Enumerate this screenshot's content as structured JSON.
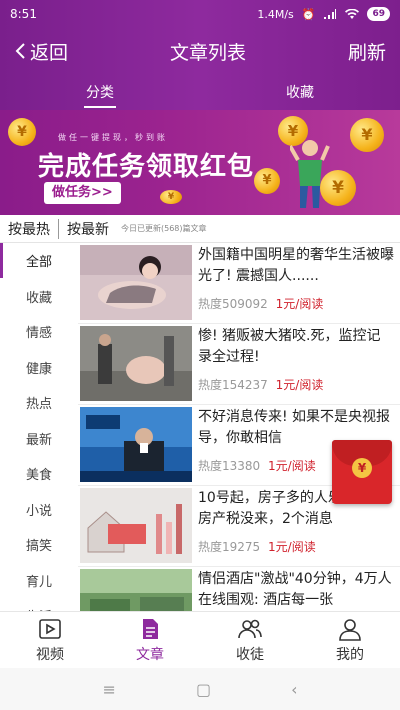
{
  "status": {
    "time": "8:51",
    "speed": "1.4M/s",
    "battery": "69"
  },
  "header": {
    "back_label": "返回",
    "title": "文章列表",
    "refresh_label": "刷新"
  },
  "subtabs": [
    {
      "label": "分类"
    },
    {
      "label": "收藏"
    }
  ],
  "banner": {
    "small_text": "做任一键提现，秒到账",
    "main_text": "完成任务领取红包",
    "button_label": "做任务>>"
  },
  "filter": {
    "hot_label": "按最热",
    "new_label": "按最新",
    "update_note": "今日已更新(568)篇文章"
  },
  "categories": [
    "全部",
    "收藏",
    "情感",
    "健康",
    "热点",
    "最新",
    "美食",
    "小说",
    "搞笑",
    "育儿",
    "生活"
  ],
  "articles": [
    {
      "title": "外国籍中国明星的奢华生活被曝 光了! 震撼国人......",
      "heat_label": "热度509092",
      "price": "1元/阅读"
    },
    {
      "title": "惨! 猪贩被大猪咬.死，监控记录全过程!",
      "heat_label": "热度154237",
      "price": "1元/阅读"
    },
    {
      "title": "不好消息传来! 如果不是央视报导，你敢相信",
      "heat_label": "热度13380",
      "price": "1元/阅读"
    },
    {
      "title": "10号起，房子多的人乐坏了，房产税没来，2个消息",
      "heat_label": "热度19275",
      "price": "1元/阅读"
    },
    {
      "title": "情侣酒店\"激战\"40分钟，4万人在线围观: 酒店每一张",
      "heat_label": "",
      "price": ""
    }
  ],
  "tabbar": [
    {
      "label": "视频",
      "icon": "video-icon"
    },
    {
      "label": "文章",
      "icon": "article-icon"
    },
    {
      "label": "收徒",
      "icon": "recruit-icon"
    },
    {
      "label": "我的",
      "icon": "profile-icon"
    }
  ],
  "colors": {
    "brand": "#8e2a9e",
    "price": "#d0222d"
  }
}
